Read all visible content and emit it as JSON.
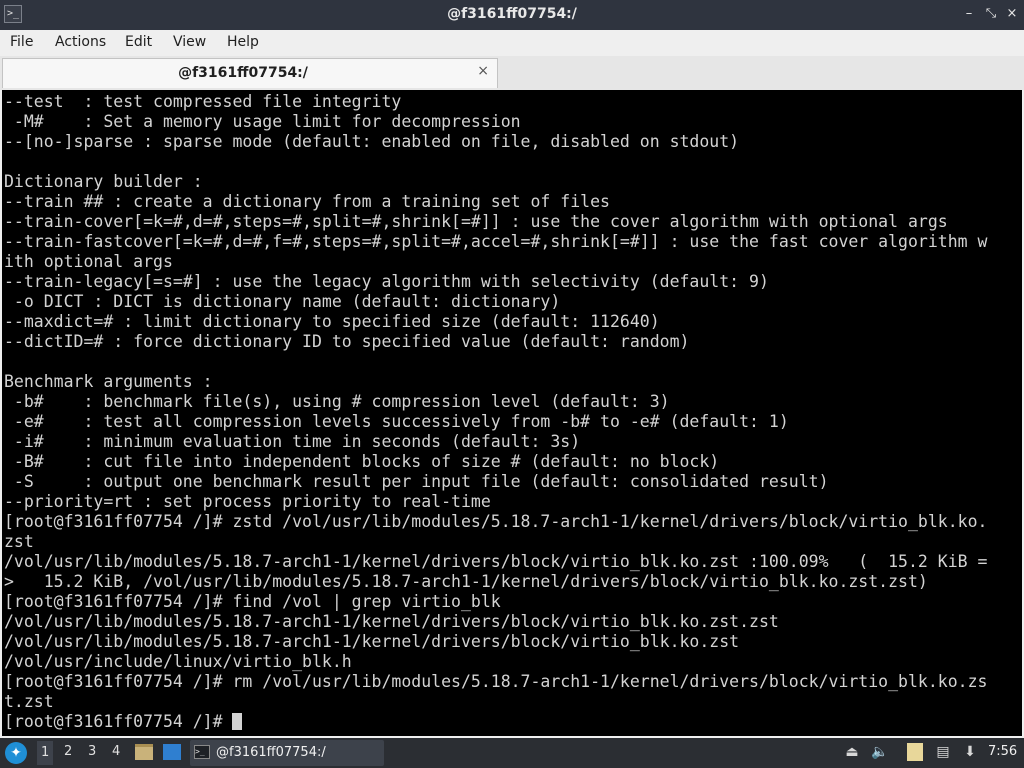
{
  "window": {
    "title": "@f3161ff07754:/",
    "buttons": {
      "minimize": "–",
      "restore": "⤡",
      "close": "×"
    }
  },
  "menubar": {
    "items": [
      "File",
      "Actions",
      "Edit",
      "View",
      "Help"
    ]
  },
  "tabs": [
    {
      "label": "@f3161ff07754:/",
      "close": "×"
    }
  ],
  "terminal": {
    "lines": [
      "--test  : test compressed file integrity",
      " -M#    : Set a memory usage limit for decompression",
      "--[no-]sparse : sparse mode (default: enabled on file, disabled on stdout)",
      "",
      "Dictionary builder :",
      "--train ## : create a dictionary from a training set of files",
      "--train-cover[=k=#,d=#,steps=#,split=#,shrink[=#]] : use the cover algorithm with optional args",
      "--train-fastcover[=k=#,d=#,f=#,steps=#,split=#,accel=#,shrink[=#]] : use the fast cover algorithm w",
      "ith optional args",
      "--train-legacy[=s=#] : use the legacy algorithm with selectivity (default: 9)",
      " -o DICT : DICT is dictionary name (default: dictionary)",
      "--maxdict=# : limit dictionary to specified size (default: 112640)",
      "--dictID=# : force dictionary ID to specified value (default: random)",
      "",
      "Benchmark arguments :",
      " -b#    : benchmark file(s), using # compression level (default: 3)",
      " -e#    : test all compression levels successively from -b# to -e# (default: 1)",
      " -i#    : minimum evaluation time in seconds (default: 3s)",
      " -B#    : cut file into independent blocks of size # (default: no block)",
      " -S     : output one benchmark result per input file (default: consolidated result)",
      "--priority=rt : set process priority to real-time",
      "[root@f3161ff07754 /]# zstd /vol/usr/lib/modules/5.18.7-arch1-1/kernel/drivers/block/virtio_blk.ko.",
      "zst",
      "/vol/usr/lib/modules/5.18.7-arch1-1/kernel/drivers/block/virtio_blk.ko.zst :100.09%   (  15.2 KiB =",
      ">   15.2 KiB, /vol/usr/lib/modules/5.18.7-arch1-1/kernel/drivers/block/virtio_blk.ko.zst.zst)",
      "[root@f3161ff07754 /]# find /vol | grep virtio_blk",
      "/vol/usr/lib/modules/5.18.7-arch1-1/kernel/drivers/block/virtio_blk.ko.zst.zst",
      "/vol/usr/lib/modules/5.18.7-arch1-1/kernel/drivers/block/virtio_blk.ko.zst",
      "/vol/usr/include/linux/virtio_blk.h",
      "[root@f3161ff07754 /]# rm /vol/usr/lib/modules/5.18.7-arch1-1/kernel/drivers/block/virtio_blk.ko.zs",
      "t.zst"
    ],
    "prompt": "[root@f3161ff07754 /]# "
  },
  "taskbar": {
    "workspaces": [
      "1",
      "2",
      "3",
      "4"
    ],
    "active_workspace": "1",
    "task_label": "@f3161ff07754:/",
    "clock": "7:56",
    "icons": [
      "start-menu-icon",
      "file-manager-icon",
      "desktop-icon",
      "terminal-icon",
      "eject-icon",
      "volume-icon",
      "clipboard-icon",
      "network-icon",
      "update-icon"
    ]
  },
  "colors": {
    "terminal_bg": "#000000",
    "terminal_fg": "#d3d3d3",
    "titlebar_bg": "#2f343f",
    "taskbar_bg": "#2b2e33"
  }
}
